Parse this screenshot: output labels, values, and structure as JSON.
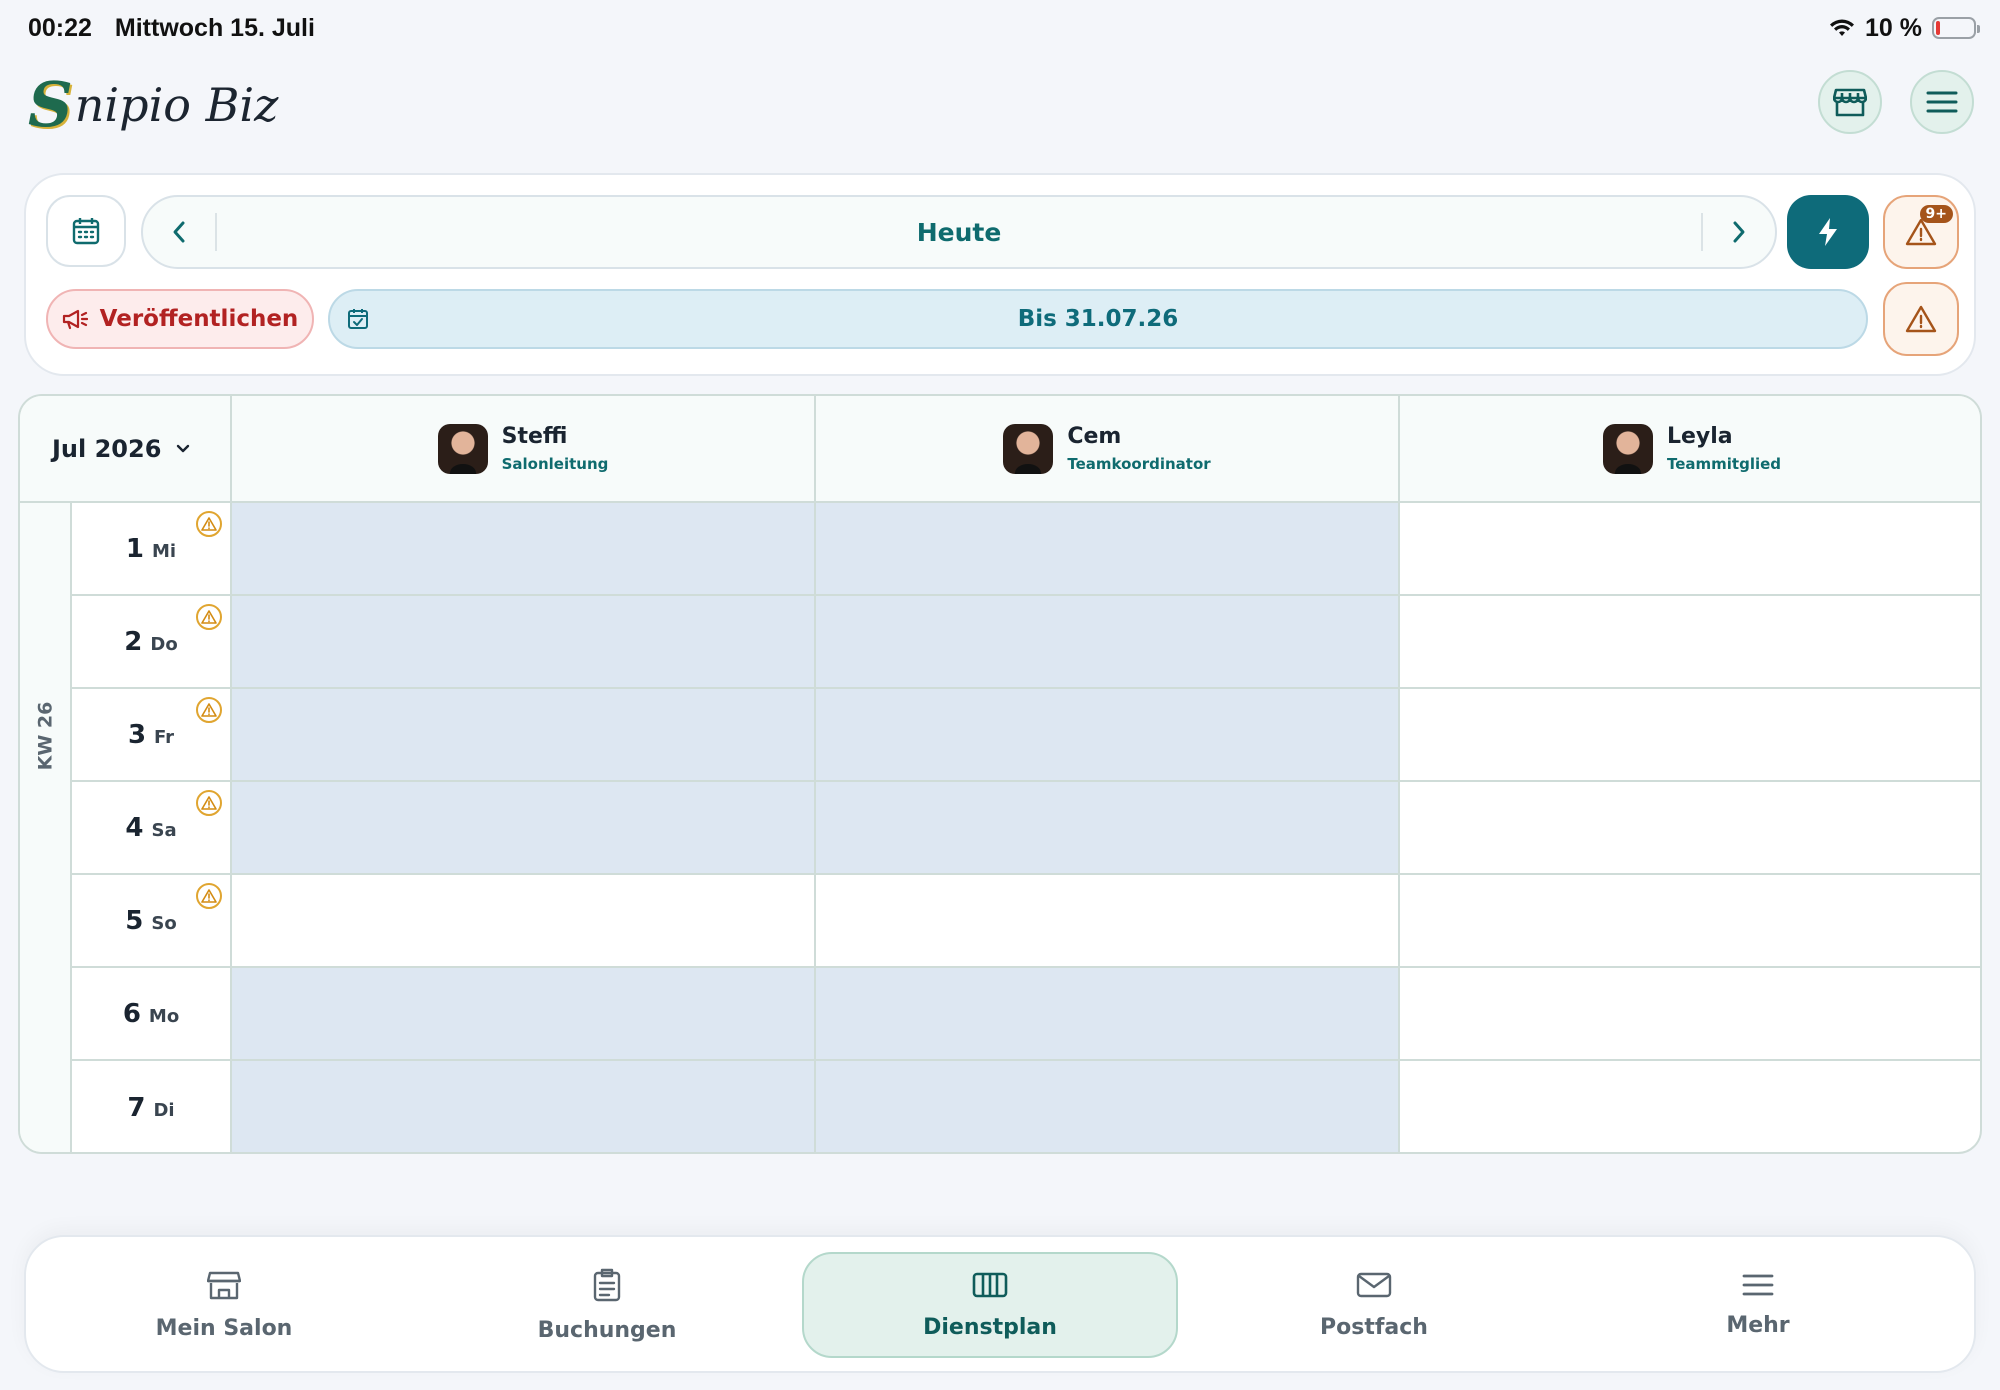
{
  "status_bar": {
    "time": "00:22",
    "date": "Mittwoch 15. Juli",
    "battery": "10 %",
    "battery_level": 0.1
  },
  "header": {
    "logo_initial": "S",
    "logo_rest": "nipio Biz",
    "store_icon": "store-icon",
    "menu_icon": "menu-icon"
  },
  "toolbar": {
    "today_label": "Heute",
    "prev_icon": "chevron-left-icon",
    "next_icon": "chevron-right-icon",
    "alerts_badge": "9+",
    "publish_label": "Veröffentlichen",
    "until_label": "Bis 31.07.26"
  },
  "schedule": {
    "month_label": "Jul 2026",
    "employees": [
      {
        "name": "Steffi",
        "role": "Salonleitung"
      },
      {
        "name": "Cem",
        "role": "Teamkoordinator"
      },
      {
        "name": "Leyla",
        "role": "Teammitglied"
      }
    ],
    "week_label": "KW 26",
    "days": [
      {
        "num": "1",
        "weekday": "Mi",
        "warning": true,
        "shaded": [
          true,
          true,
          false
        ]
      },
      {
        "num": "2",
        "weekday": "Do",
        "warning": true,
        "shaded": [
          true,
          true,
          false
        ]
      },
      {
        "num": "3",
        "weekday": "Fr",
        "warning": true,
        "shaded": [
          true,
          true,
          false
        ]
      },
      {
        "num": "4",
        "weekday": "Sa",
        "warning": true,
        "shaded": [
          true,
          true,
          false
        ]
      },
      {
        "num": "5",
        "weekday": "So",
        "warning": true,
        "shaded": [
          false,
          false,
          false
        ]
      },
      {
        "num": "6",
        "weekday": "Mo",
        "warning": false,
        "shaded": [
          true,
          true,
          false
        ]
      },
      {
        "num": "7",
        "weekday": "Di",
        "warning": false,
        "shaded": [
          true,
          true,
          false
        ]
      }
    ]
  },
  "tabs": [
    {
      "label": "Mein Salon",
      "icon": "store-icon",
      "active": false
    },
    {
      "label": "Buchungen",
      "icon": "clipboard-icon",
      "active": false
    },
    {
      "label": "Dienstplan",
      "icon": "columns-icon",
      "active": true
    },
    {
      "label": "Postfach",
      "icon": "mail-icon",
      "active": false
    },
    {
      "label": "Mehr",
      "icon": "menu-icon",
      "active": false
    }
  ],
  "colors": {
    "accent": "#0f6b6e",
    "shift_fill": "#dde7f2",
    "publish": "#b22222",
    "warning": "#d38b12"
  }
}
